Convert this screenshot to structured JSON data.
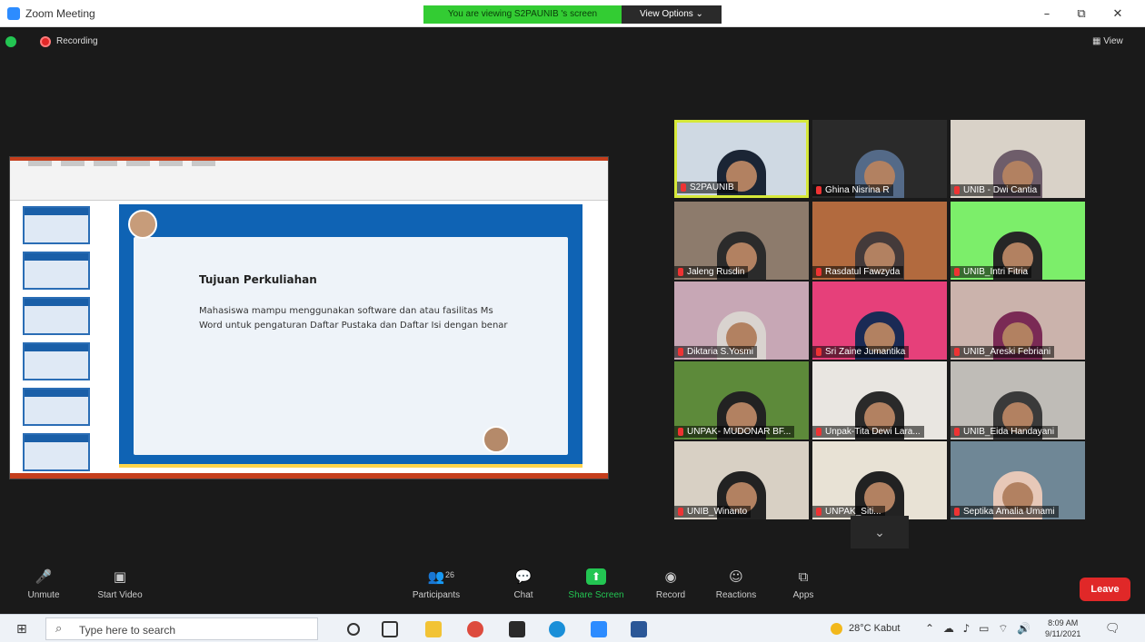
{
  "window": {
    "title": "Zoom Meeting",
    "banner": "You are viewing S2PAUNIB 's screen",
    "view_options": "View Options ⌄",
    "minimize": "–",
    "restore": "⧉",
    "close": "✕"
  },
  "top": {
    "recording": "Recording",
    "view": "▦ View"
  },
  "slide": {
    "title": "Tujuan Perkuliahan",
    "body": "Mahasiswa mampu menggunakan software dan atau fasilitas Ms Word untuk pengaturan Daftar Pustaka dan Daftar Isi dengan benar"
  },
  "participants": [
    {
      "name": "S2PAUNIB",
      "active": true,
      "bg": "#cfd9e3",
      "hijab": "#1b2535"
    },
    {
      "name": "Ghina Nisrina R",
      "bg": "#2a2a2a",
      "hijab": "#546a88"
    },
    {
      "name": "UNIB - Dwi Cantia",
      "bg": "#d9d2c8",
      "hijab": "#6e5d6a"
    },
    {
      "name": "Jaleng Rusdin",
      "bg": "#8d7b6c",
      "hijab": "#2b2b2b"
    },
    {
      "name": "Rasdatul Fawzyda",
      "bg": "#b26a3e",
      "hijab": "#443a3a"
    },
    {
      "name": "UNIB_Intri Fitria",
      "bg": "#7cee6a",
      "hijab": "#262626"
    },
    {
      "name": "Diktaria S.Yosmi",
      "bg": "#c7a7b5",
      "hijab": "#d9d3cf"
    },
    {
      "name": "Sri Zaine Jumantika",
      "bg": "#e6407a",
      "hijab": "#1a2a55"
    },
    {
      "name": "UNIB_Areski Febriani",
      "bg": "#cbb3ac",
      "hijab": "#7a2a55"
    },
    {
      "name": "UNPAK- MUDONAR BF...",
      "bg": "#5d8a3a",
      "hijab": "#222222"
    },
    {
      "name": "Unpak-Tita Dewi Lara...",
      "bg": "#e9e6e1",
      "hijab": "#2a2a2a"
    },
    {
      "name": "UNIB_Eida Handayani",
      "bg": "#bfbcb7",
      "hijab": "#3a3a3a"
    },
    {
      "name": "UNIB_Winanto",
      "bg": "#d8d0c4",
      "hijab": "#222222"
    },
    {
      "name": "UNPAK_Siti...",
      "bg": "#e8e2d5",
      "hijab": "#222222"
    },
    {
      "name": "Septika Amalia Umami",
      "bg": "#6f8796",
      "hijab": "#e7c8b8"
    }
  ],
  "more": "⌄",
  "toolbar": {
    "unmute": "Unmute",
    "start_video": "Start Video",
    "participants": "Participants",
    "participants_count": "26",
    "chat": "Chat",
    "share_screen": "Share Screen",
    "record": "Record",
    "reactions": "Reactions",
    "apps": "Apps",
    "leave": "Leave"
  },
  "taskbar": {
    "search_placeholder": "Type here to search",
    "weather": "28°C  Kabut",
    "time": "8:09 AM",
    "date": "9/11/2021"
  }
}
